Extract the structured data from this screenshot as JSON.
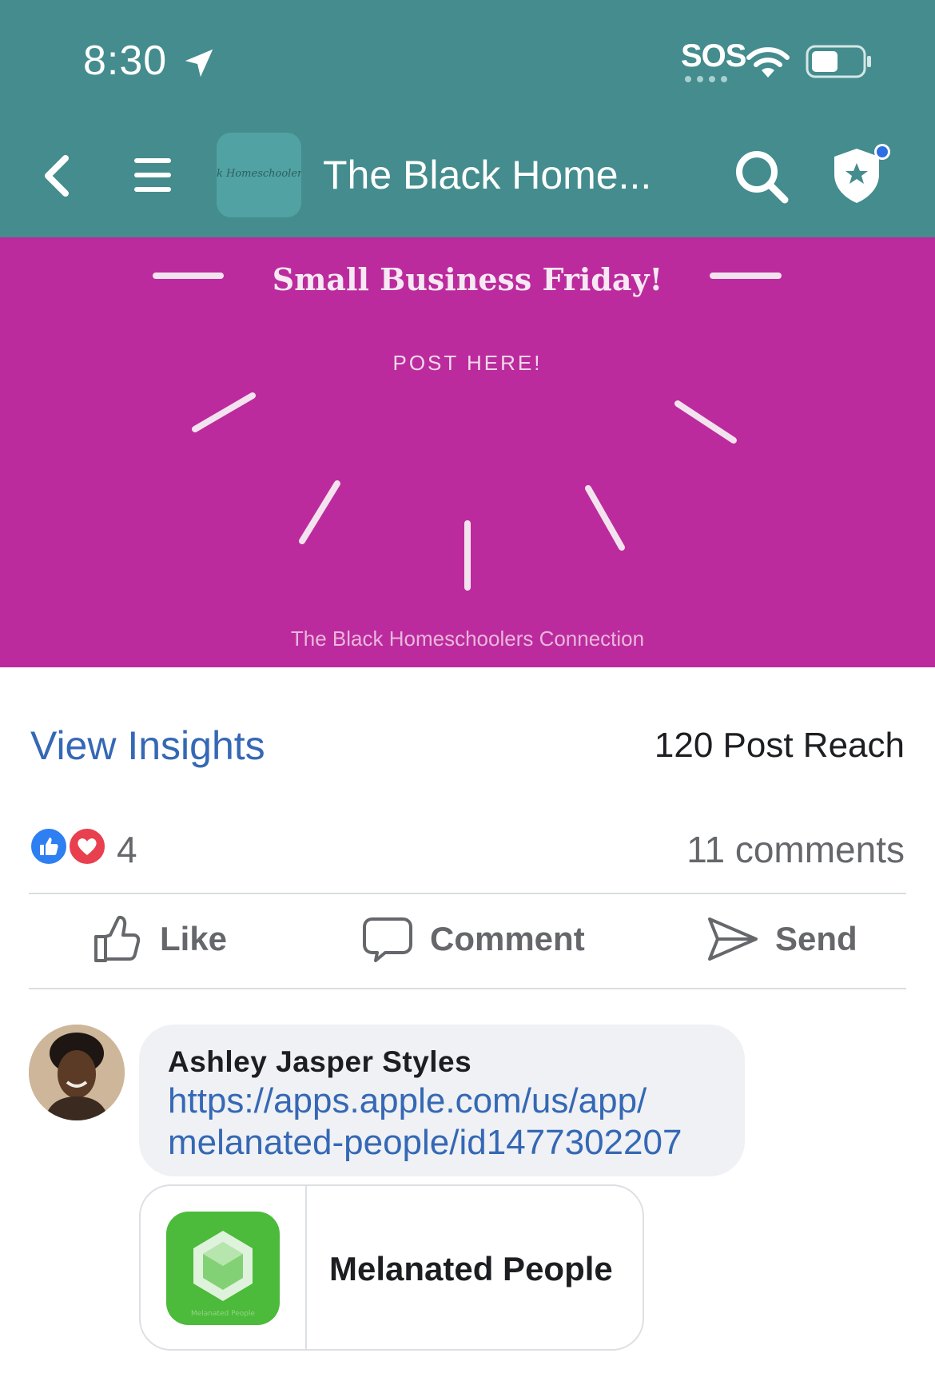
{
  "status_bar": {
    "time": "8:30",
    "sos": "SOS"
  },
  "nav": {
    "title": "The Black Home...",
    "avatar_text": "k Homeschoolers C"
  },
  "post_image": {
    "title": "Small Business Friday!",
    "subtitle": "POST HERE!",
    "footer": "The Black Homeschoolers Connection",
    "background_color": "#bc2b9d"
  },
  "insights": {
    "link_label": "View Insights",
    "reach": "120 Post Reach"
  },
  "reactions": {
    "count": "4",
    "comments": "11 comments",
    "types": [
      "like",
      "love"
    ]
  },
  "actions": {
    "like": "Like",
    "comment": "Comment",
    "send": "Send"
  },
  "comment": {
    "author": "Ashley Jasper Styles",
    "link_line1": "https://apps.apple.com/us/app/",
    "link_line2": "melanated-people/id1477302207"
  },
  "link_preview": {
    "title": "Melanated People",
    "app_icon_caption": "Melanated People"
  },
  "colors": {
    "header_bg": "#448c8d",
    "link_blue": "#3568b5",
    "app_green": "#4cba3a"
  }
}
